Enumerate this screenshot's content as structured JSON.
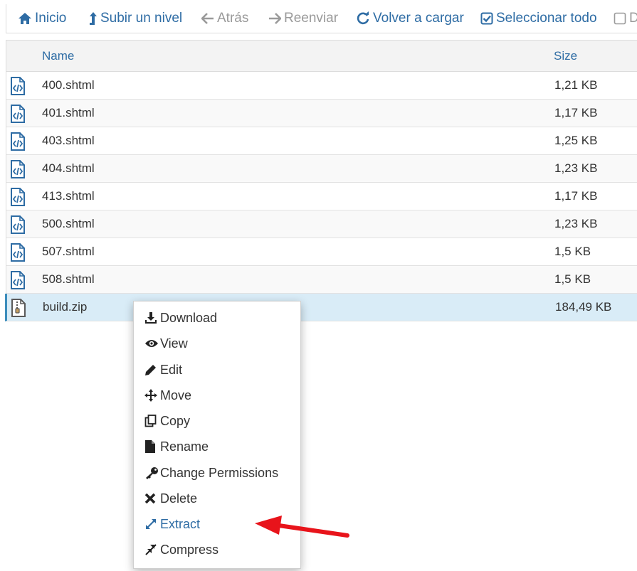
{
  "toolbar": {
    "home": "Inicio",
    "up": "Subir un nivel",
    "back": "Atrás",
    "forward": "Reenviar",
    "reload": "Volver a cargar",
    "select_all": "Seleccionar todo",
    "deselect_partial": "D"
  },
  "table": {
    "columns": {
      "name": "Name",
      "size": "Size"
    },
    "rows": [
      {
        "name": "400.shtml",
        "size": "1,21 KB",
        "icon": "html-file-icon"
      },
      {
        "name": "401.shtml",
        "size": "1,17 KB",
        "icon": "html-file-icon"
      },
      {
        "name": "403.shtml",
        "size": "1,25 KB",
        "icon": "html-file-icon"
      },
      {
        "name": "404.shtml",
        "size": "1,23 KB",
        "icon": "html-file-icon"
      },
      {
        "name": "413.shtml",
        "size": "1,17 KB",
        "icon": "html-file-icon"
      },
      {
        "name": "500.shtml",
        "size": "1,23 KB",
        "icon": "html-file-icon"
      },
      {
        "name": "507.shtml",
        "size": "1,5 KB",
        "icon": "html-file-icon"
      },
      {
        "name": "508.shtml",
        "size": "1,5 KB",
        "icon": "html-file-icon"
      },
      {
        "name": "build.zip",
        "size": "184,49 KB",
        "icon": "zip-file-icon"
      }
    ]
  },
  "context_menu": {
    "items": [
      {
        "label": "Download",
        "icon": "download-icon"
      },
      {
        "label": "View",
        "icon": "eye-icon"
      },
      {
        "label": "Edit",
        "icon": "pencil-icon"
      },
      {
        "label": "Move",
        "icon": "move-icon"
      },
      {
        "label": "Copy",
        "icon": "copy-icon"
      },
      {
        "label": "Rename",
        "icon": "file-icon"
      },
      {
        "label": "Change Permissions",
        "icon": "key-icon"
      },
      {
        "label": "Delete",
        "icon": "delete-x-icon"
      },
      {
        "label": "Extract",
        "icon": "expand-arrows-icon"
      },
      {
        "label": "Compress",
        "icon": "compress-arrows-icon"
      }
    ]
  },
  "colors": {
    "link_blue": "#2e6ca4",
    "disabled_gray": "#9a9a9a",
    "selected_row": "#d9ecf7",
    "annotation_red": "#e8141b"
  }
}
